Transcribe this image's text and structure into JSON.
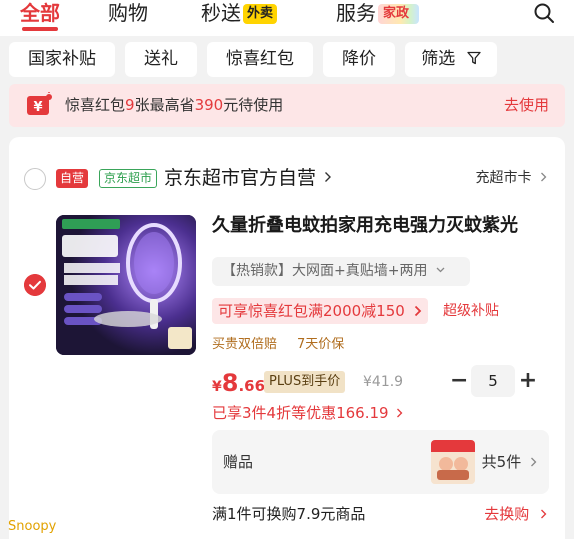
{
  "tabs": {
    "all": "全部",
    "shopping": "购物",
    "express": "秒送",
    "express_badge": "外卖",
    "services": "服务",
    "services_badge": "家政"
  },
  "filters": [
    "国家补贴",
    "送礼",
    "惊喜红包",
    "降价",
    "筛选"
  ],
  "promo": {
    "prefix": "惊喜红包",
    "count": "9",
    "middle": "张最高省",
    "amount": "390",
    "suffix": "元待使用",
    "link": "去使用"
  },
  "store": {
    "tag_self": "自营",
    "tag_jd": "京东超市",
    "name": "京东超市官方自营",
    "card_link": "充超市卡"
  },
  "product": {
    "title": "久量折叠电蚊拍家用充电强力灭蚊紫光",
    "variant": "【热销款】大网面+真贴墙+两用",
    "coupon": "可享惊喜红包满2000减150",
    "subsidy": "超级补贴",
    "services": [
      "买贵双倍赔",
      "7天价保"
    ],
    "price_currency": "¥",
    "price_int": "8",
    "price_dec": ".66",
    "plus_badge": "PLUS到手价",
    "ref_price": "¥41.9",
    "quantity": "5",
    "discount": "已享3件4折等优惠166.19",
    "gift_label": "赠品",
    "gift_count": "共5件",
    "addon_text": "满1件可换购7.9元商品",
    "addon_link": "去换购"
  },
  "watermark": "Snoopy",
  "colors": {
    "accent": "#e4393c",
    "jd_green": "#2b9e4c",
    "service_gold": "#b06d1e"
  }
}
